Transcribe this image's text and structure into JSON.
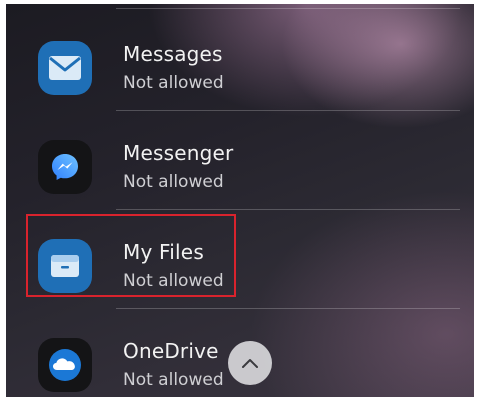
{
  "apps": [
    {
      "name": "Messages",
      "status": "Not allowed",
      "icon": "envelope-icon"
    },
    {
      "name": "Messenger",
      "status": "Not allowed",
      "icon": "messenger-bolt-icon"
    },
    {
      "name": "My Files",
      "status": "Not allowed",
      "icon": "folder-icon"
    },
    {
      "name": "OneDrive",
      "status": "Not allowed",
      "icon": "cloud-icon"
    }
  ],
  "colors": {
    "highlight": "#d9232d",
    "messages_icon_bg": "#1f6fb6",
    "messenger_icon_bg": "#141416",
    "myfiles_icon_bg": "#1f6fb6",
    "onedrive_icon_bg": "#141416"
  },
  "scroll_button": {
    "icon": "chevron-up-icon"
  }
}
